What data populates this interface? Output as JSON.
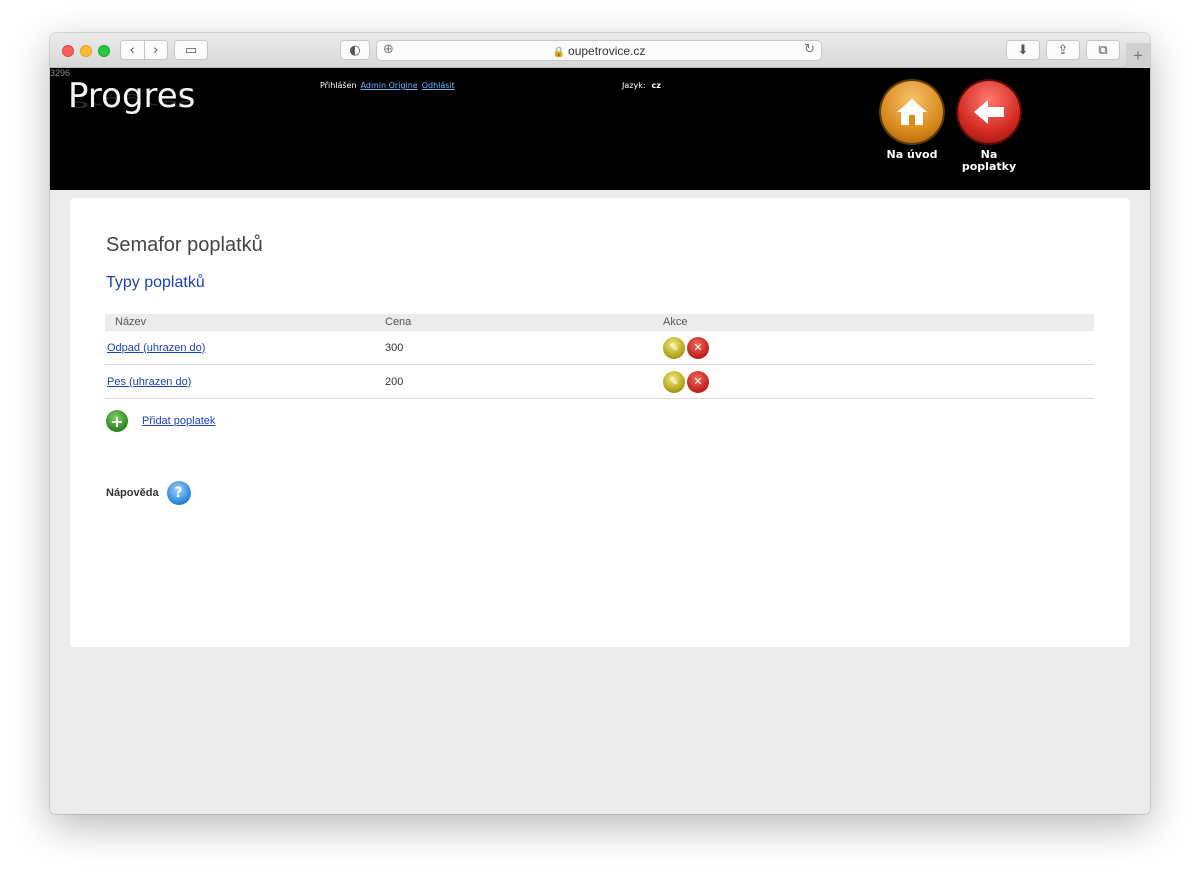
{
  "browser": {
    "url": "oupetrovice.cz",
    "icons": {
      "back": "‹",
      "forward": "›",
      "sidebar": "▭",
      "shield": "◐",
      "compass": "⊕",
      "lock": "🔒",
      "reload": "↻",
      "download": "⬇",
      "share": "⇪",
      "tabs": "⧉",
      "new_tab": "+"
    }
  },
  "header": {
    "counter": "3296",
    "logo": "Progres",
    "login_prefix": "Přihlášen",
    "user_name": "Admin Origine",
    "logout": "Odhlásit",
    "lang_label": "Jazyk:",
    "lang_value": "cz",
    "home_button": "Na úvod",
    "back_button_line1": "Na",
    "back_button_line2": "poplatky"
  },
  "page": {
    "title": "Semafor poplatků",
    "section_title": "Typy poplatků",
    "columns": [
      "Název",
      "Cena",
      "Akce"
    ],
    "rows": [
      {
        "name": "Odpad (uhrazen do)",
        "price": "300"
      },
      {
        "name": "Pes (uhrazen do)",
        "price": "200"
      }
    ],
    "add_label": "Přidat poplatek",
    "help_label": "Nápověda"
  },
  "colors": {
    "link": "#1c43b4",
    "header_bg": "#000000",
    "home_orange": "#d98a1c",
    "back_red": "#d32b22"
  }
}
